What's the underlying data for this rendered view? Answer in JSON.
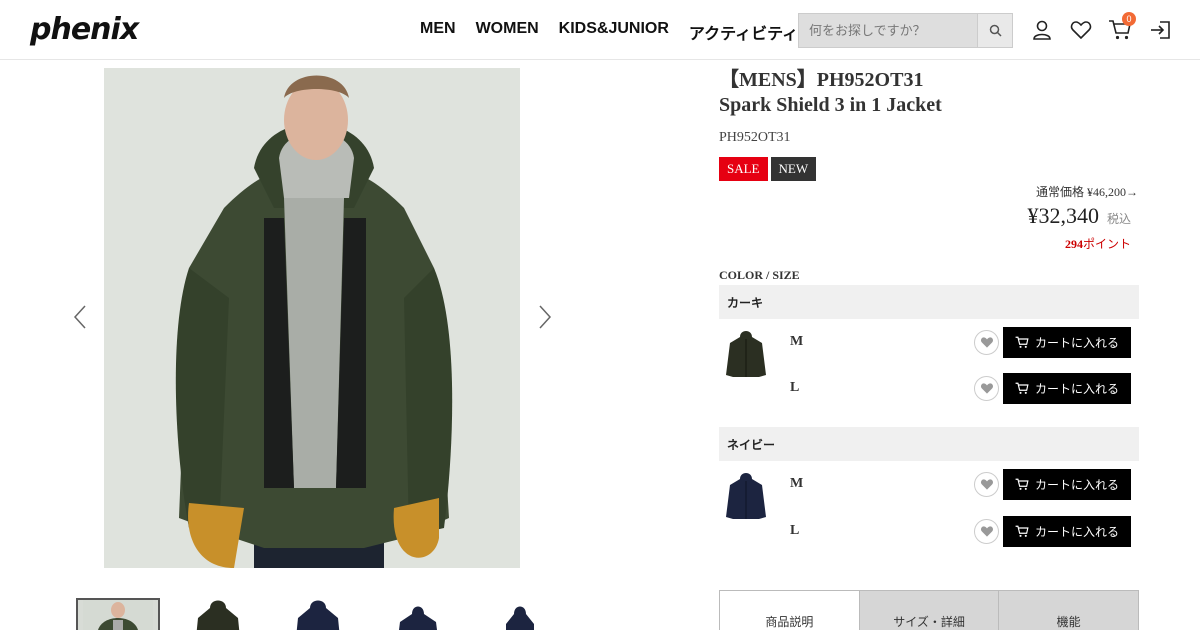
{
  "header": {
    "logo": "phenix",
    "nav": [
      "MEN",
      "WOMEN",
      "KIDS&JUNIOR",
      "アクティビティ"
    ],
    "search_placeholder": "何をお探しですか？",
    "cart_count": "0"
  },
  "product": {
    "title_line1": "【MENS】PH952OT31",
    "title_line2": "Spark Shield 3 in 1 Jacket",
    "code": "PH952OT31",
    "badges": [
      "SALE",
      "NEW"
    ],
    "regular_price": "通常価格 ¥46,200→",
    "price": "¥32,340",
    "tax_label": "税込",
    "points_value": "294",
    "points_label": "ポイント"
  },
  "options": {
    "section_label": "COLOR / SIZE",
    "colors": [
      {
        "name": "カーキ",
        "swatch_color": "#2b2f22",
        "sizes": [
          "M",
          "L"
        ]
      },
      {
        "name": "ネイビー",
        "swatch_color": "#1c2440",
        "sizes": [
          "M",
          "L"
        ]
      }
    ],
    "cart_button_label": "カートに入れる"
  },
  "tabs": [
    "商品説明",
    "サイズ・詳細",
    "機能"
  ],
  "colors": {
    "sale": "#e60012",
    "new": "#333333",
    "cart_badge": "#f26a35",
    "points": "#cc0000",
    "jacket_khaki": "#3d4a33",
    "image_bg": "#dfe3dd"
  }
}
